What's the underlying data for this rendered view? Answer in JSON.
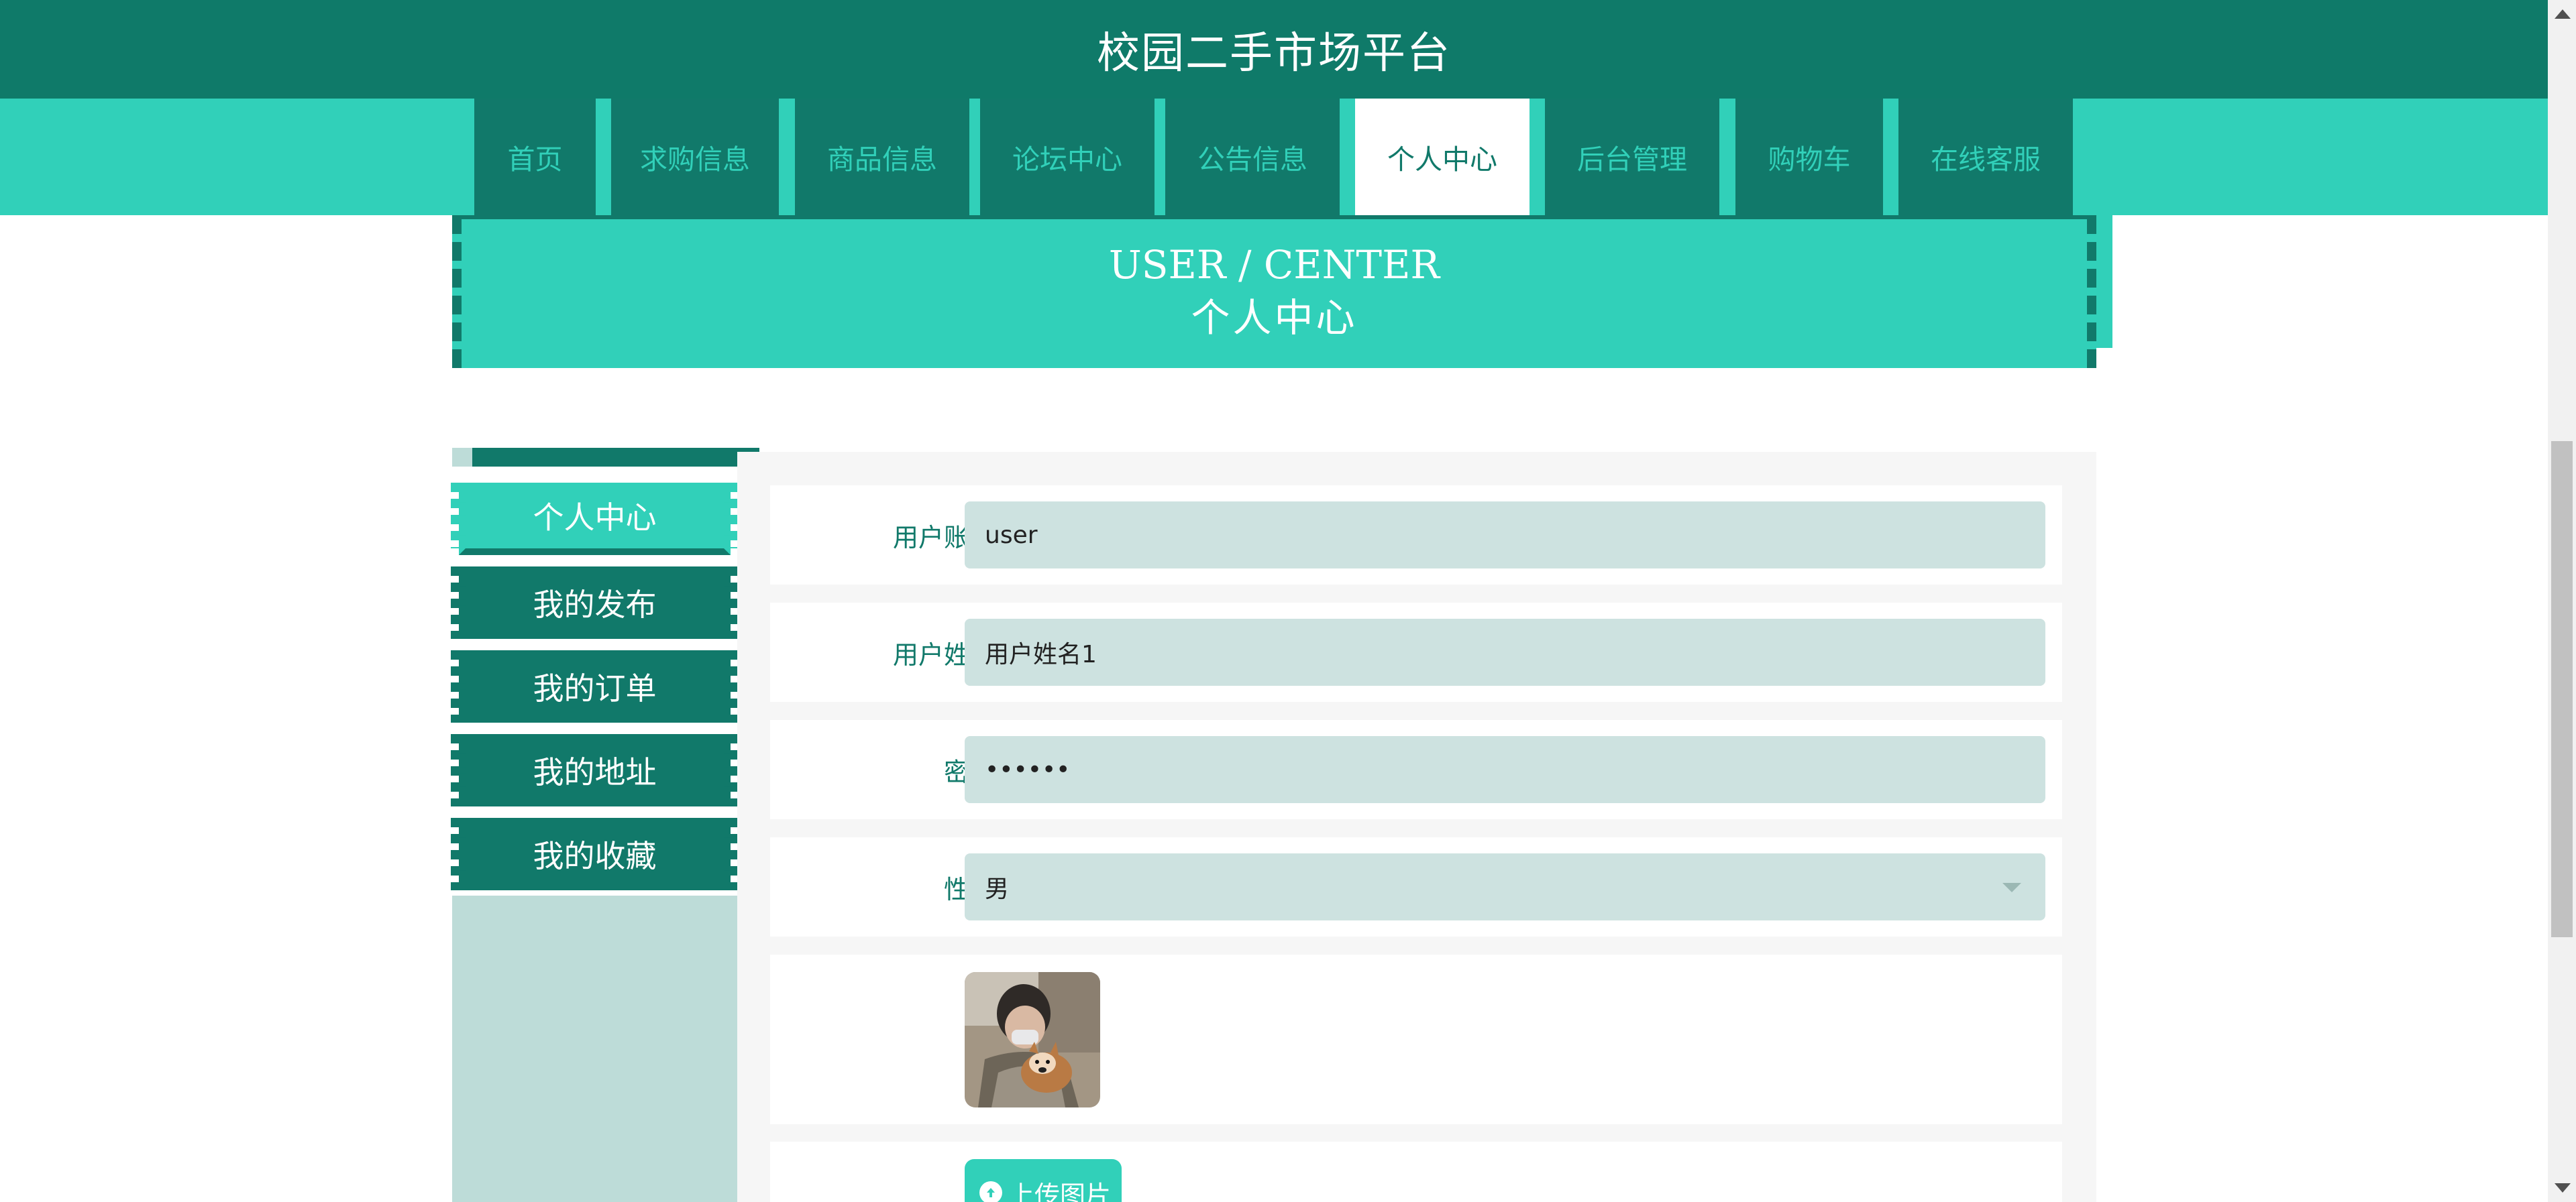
{
  "site": {
    "title": "校园二手市场平台"
  },
  "nav": {
    "items": [
      {
        "label": "首页"
      },
      {
        "label": "求购信息"
      },
      {
        "label": "商品信息"
      },
      {
        "label": "论坛中心"
      },
      {
        "label": "公告信息"
      },
      {
        "label": "个人中心",
        "active": true
      },
      {
        "label": "后台管理"
      },
      {
        "label": "购物车"
      },
      {
        "label": "在线客服"
      }
    ]
  },
  "banner": {
    "title_en": "USER / CENTER",
    "title_cn": "个人中心"
  },
  "sidebar": {
    "items": [
      {
        "label": "个人中心",
        "active": true
      },
      {
        "label": "我的发布"
      },
      {
        "label": "我的订单"
      },
      {
        "label": "我的地址"
      },
      {
        "label": "我的收藏"
      }
    ]
  },
  "form": {
    "account": {
      "label": "用户账号",
      "value": "user"
    },
    "name": {
      "label": "用户姓名",
      "value": "用户姓名1"
    },
    "password": {
      "label": "密码",
      "value": "••••••"
    },
    "gender": {
      "label": "性别",
      "value": "男"
    },
    "avatar": {
      "description": "person-holding-dog-photo"
    },
    "upload": {
      "label": "上传图片",
      "icon": "upload-icon"
    }
  },
  "colors": {
    "primary_dark": "#11796a",
    "primary_light": "#31d0b9",
    "field_bg": "#cde2e0",
    "sidebar_bg": "#bddcd8"
  }
}
